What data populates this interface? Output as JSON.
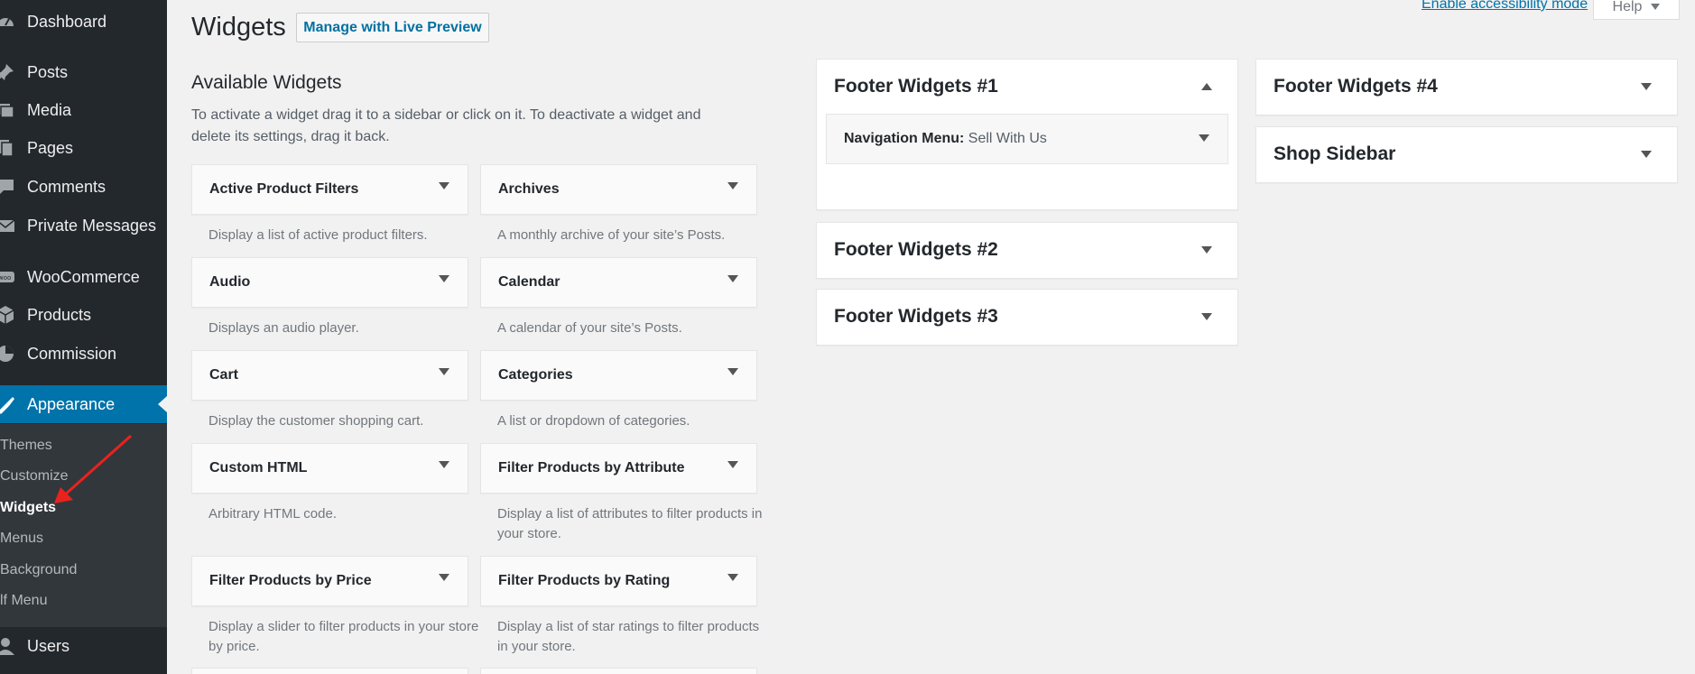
{
  "sidebar": {
    "items": [
      {
        "label": "Dashboard",
        "icon": "dashboard-icon"
      },
      {
        "label": "Posts",
        "icon": "pin-icon"
      },
      {
        "label": "Media",
        "icon": "media-icon"
      },
      {
        "label": "Pages",
        "icon": "pages-icon"
      },
      {
        "label": "Comments",
        "icon": "comments-icon"
      },
      {
        "label": "Private Messages",
        "icon": "envelope-icon"
      },
      {
        "label": "WooCommerce",
        "icon": "woo-icon"
      },
      {
        "label": "Products",
        "icon": "cube-icon"
      },
      {
        "label": "Commission",
        "icon": "pie-chart-icon"
      },
      {
        "label": "Appearance",
        "icon": "brush-icon"
      },
      {
        "label": "Users",
        "icon": "user-icon"
      }
    ],
    "submenu": [
      "Themes",
      "Customize",
      "Widgets",
      "Menus",
      "Background",
      "lf Menu"
    ]
  },
  "header": {
    "title": "Widgets",
    "live_preview": "Manage with Live Preview",
    "accessibility": "Enable accessibility mode",
    "help": "Help"
  },
  "available": {
    "title": "Available Widgets",
    "description": "To activate a widget drag it to a sidebar or click on it. To deactivate a widget and delete its settings, drag it back.",
    "widgets": [
      {
        "title": "Active Product Filters",
        "desc": "Display a list of active product filters."
      },
      {
        "title": "Archives",
        "desc": "A monthly archive of your site’s Posts."
      },
      {
        "title": "Audio",
        "desc": "Displays an audio player."
      },
      {
        "title": "Calendar",
        "desc": "A calendar of your site’s Posts."
      },
      {
        "title": "Cart",
        "desc": "Display the customer shopping cart."
      },
      {
        "title": "Categories",
        "desc": "A list or dropdown of categories."
      },
      {
        "title": "Custom HTML",
        "desc": "Arbitrary HTML code."
      },
      {
        "title": "Filter Products by Attribute",
        "desc": "Display a list of attributes to filter products in your store."
      },
      {
        "title": "Filter Products by Price",
        "desc": "Display a slider to filter products in your store by price."
      },
      {
        "title": "Filter Products by Rating",
        "desc": "Display a list of star ratings to filter products in your store."
      }
    ]
  },
  "areas": {
    "footer1": {
      "title": "Footer Widgets #1",
      "widget_name": "Navigation Menu",
      "widget_title": "Sell With Us"
    },
    "footer2": {
      "title": "Footer Widgets #2"
    },
    "footer3": {
      "title": "Footer Widgets #3"
    },
    "footer4": {
      "title": "Footer Widgets #4"
    },
    "shop": {
      "title": "Shop Sidebar"
    }
  },
  "colors": {
    "accent": "#0073aa",
    "sidebar_bg": "#23282d",
    "annotation": "#e8231e"
  }
}
